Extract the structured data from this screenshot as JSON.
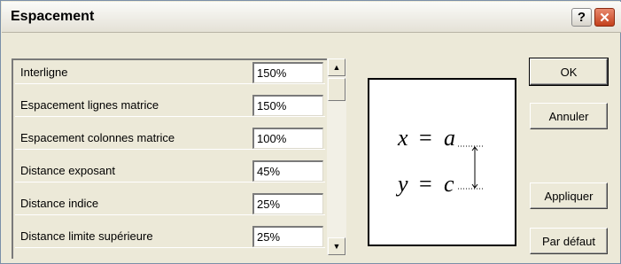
{
  "window": {
    "title": "Espacement",
    "help_label": "?",
    "close_label": "✕"
  },
  "rows": [
    {
      "label": "Interligne",
      "value": "150%"
    },
    {
      "label": "Espacement lignes matrice",
      "value": "150%"
    },
    {
      "label": "Espacement colonnes matrice",
      "value": "100%"
    },
    {
      "label": "Distance exposant",
      "value": "45%"
    },
    {
      "label": "Distance indice",
      "value": "25%"
    },
    {
      "label": "Distance limite supérieure",
      "value": "25%"
    }
  ],
  "scrollbar": {
    "up_icon": "▲",
    "down_icon": "▼"
  },
  "preview": {
    "line1_lhs": "x",
    "line1_eq": "=",
    "line1_rhs": "a",
    "line2_lhs": "y",
    "line2_eq": "=",
    "line2_rhs": "c"
  },
  "buttons": {
    "ok": "OK",
    "cancel": "Annuler",
    "apply": "Appliquer",
    "default": "Par défaut"
  }
}
